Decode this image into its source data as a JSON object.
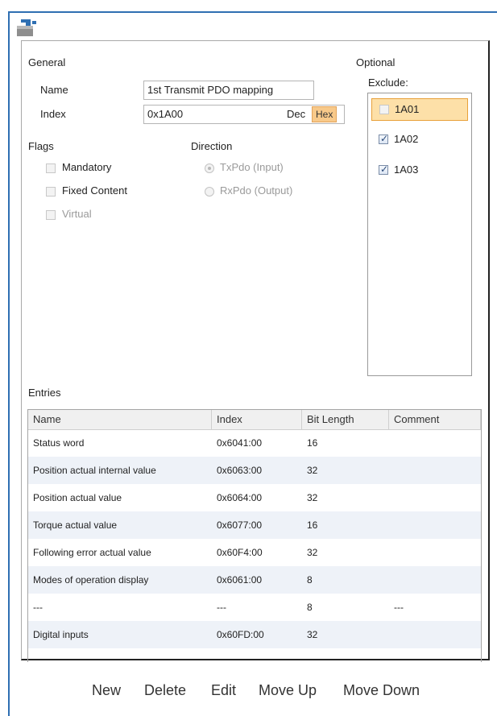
{
  "general": {
    "section_label": "General",
    "name_label": "Name",
    "name_value": "1st Transmit PDO mapping",
    "index_label": "Index",
    "index_value": "0x1A00",
    "dec_label": "Dec",
    "hex_label": "Hex"
  },
  "optional": {
    "section_label": "Optional",
    "exclude_label": "Exclude:",
    "items": [
      {
        "label": "1A01",
        "checked": false,
        "selected": true
      },
      {
        "label": "1A02",
        "checked": true,
        "selected": false
      },
      {
        "label": "1A03",
        "checked": true,
        "selected": false
      }
    ]
  },
  "flags": {
    "section_label": "Flags",
    "mandatory": "Mandatory",
    "fixed_content": "Fixed Content",
    "virtual": "Virtual"
  },
  "direction": {
    "section_label": "Direction",
    "txpdo": "TxPdo (Input)",
    "rxpdo": "RxPdo (Output)",
    "selected": "txpdo"
  },
  "entries": {
    "section_label": "Entries",
    "columns": [
      "Name",
      "Index",
      "Bit Length",
      "Comment"
    ],
    "rows": [
      {
        "name": "Status word",
        "index": "0x6041:00",
        "bits": "16",
        "comment": ""
      },
      {
        "name": "Position actual internal value",
        "index": "0x6063:00",
        "bits": "32",
        "comment": ""
      },
      {
        "name": "Position actual value",
        "index": "0x6064:00",
        "bits": "32",
        "comment": ""
      },
      {
        "name": "Torque actual value",
        "index": "0x6077:00",
        "bits": "16",
        "comment": ""
      },
      {
        "name": "Following error actual value",
        "index": "0x60F4:00",
        "bits": "32",
        "comment": ""
      },
      {
        "name": "Modes of operation display",
        "index": "0x6061:00",
        "bits": "8",
        "comment": ""
      },
      {
        "name": "---",
        "index": "---",
        "bits": "8",
        "comment": "---"
      },
      {
        "name": "Digital inputs",
        "index": "0x60FD:00",
        "bits": "32",
        "comment": ""
      }
    ]
  },
  "actions": {
    "new": "New",
    "delete": "Delete",
    "edit": "Edit",
    "move_up": "Move Up",
    "move_down": "Move Down"
  },
  "colors": {
    "frame": "#2f6fb2",
    "selection": "#fde0a8",
    "hex_button": "#f8c98a",
    "row_alt": "#eef2f8"
  },
  "icons": {
    "app": "pdo-plug-icon"
  }
}
